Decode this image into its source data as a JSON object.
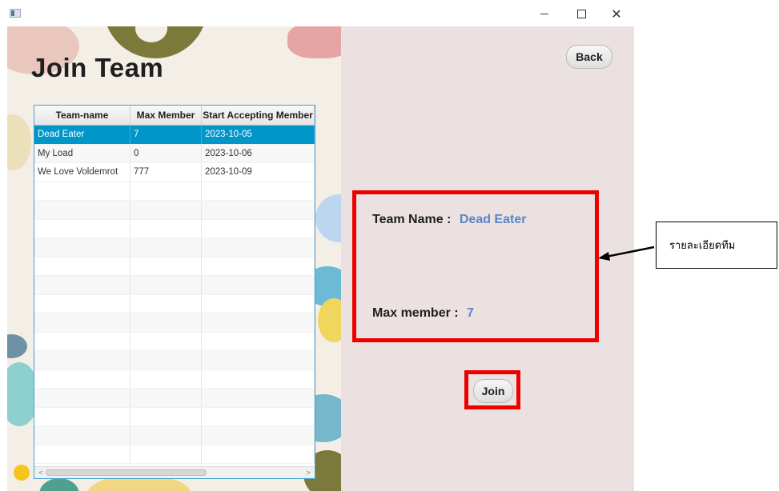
{
  "window": {
    "controls": {
      "minimize": "minimize-icon",
      "maximize": "maximize-icon",
      "close": "close-icon"
    }
  },
  "page": {
    "title": "Join Team"
  },
  "table": {
    "columns": [
      "Team-name",
      "Max Member",
      "Start Accepting Member"
    ],
    "rows": [
      {
        "name": "Dead Eater",
        "max": "7",
        "start": "2023-10-05",
        "selected": true
      },
      {
        "name": "My Load",
        "max": "0",
        "start": "2023-10-06",
        "selected": false
      },
      {
        "name": "We Love Voldemrot",
        "max": "777",
        "start": "2023-10-09",
        "selected": false
      }
    ],
    "empty_rows": 15
  },
  "buttons": {
    "back": "Back",
    "join": "Join"
  },
  "details": {
    "team_label": "Team Name :",
    "team_value": "Dead Eater",
    "max_label": "Max member :",
    "max_value": "7"
  },
  "annotation": {
    "text": "รายละเอียดทีม"
  },
  "colors": {
    "selection": "#0096c9",
    "highlight_border": "#ee0000",
    "value_text": "#5b85c8",
    "right_pane": "#ece1e1"
  }
}
